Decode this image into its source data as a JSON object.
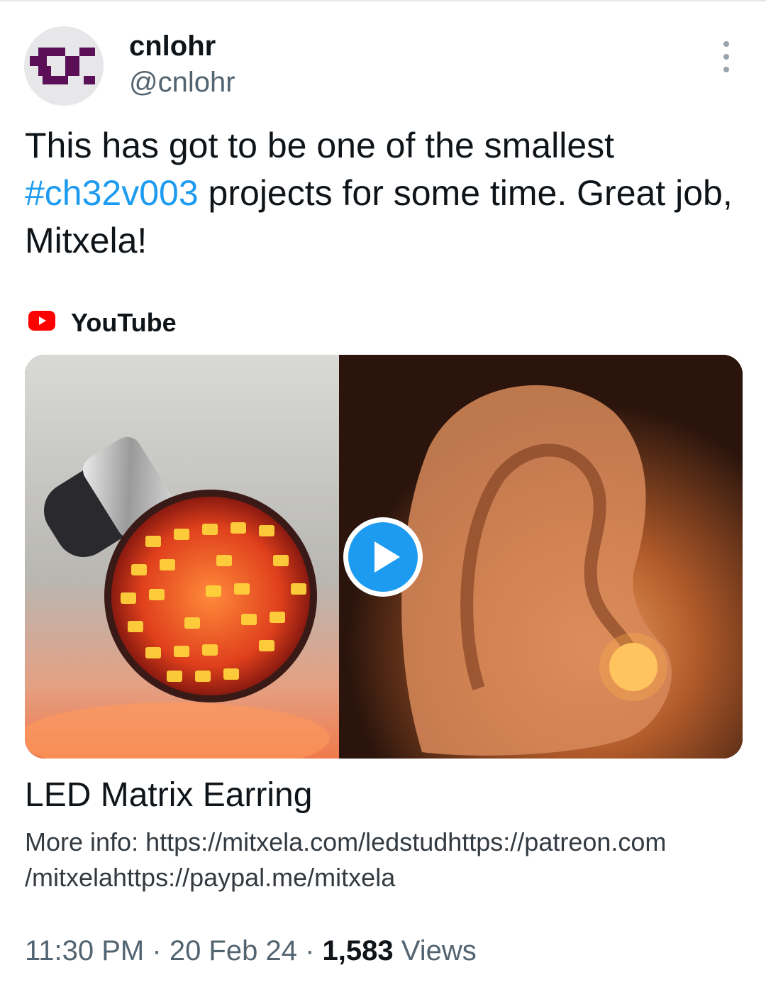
{
  "author": {
    "display_name": "cnlohr",
    "handle": "@cnlohr",
    "avatar_icon": "pixel-logo-avatar"
  },
  "tweet": {
    "text_before": "This has got to be one of the smallest ",
    "hashtag": "#ch32v003",
    "text_after": " projects for some time. Great job, Mitxela!"
  },
  "card": {
    "source_icon": "youtube-icon",
    "source_label": "YouTube",
    "title": "LED Matrix Earring",
    "description": "More info: https://mitxela.com/ledstudhttps://patreon.com /mitxelahttps://paypal.me/mitxela"
  },
  "meta": {
    "time": "11:30 PM",
    "sep1": "·",
    "date": "20 Feb 24",
    "sep2": "·",
    "views_count": "1,583",
    "views_label": "Views"
  },
  "colors": {
    "accent": "#1d9bf0",
    "text": "#0f1419",
    "muted": "#536471",
    "avatar_purple": "#5a0f57",
    "youtube_red": "#ff0000"
  }
}
